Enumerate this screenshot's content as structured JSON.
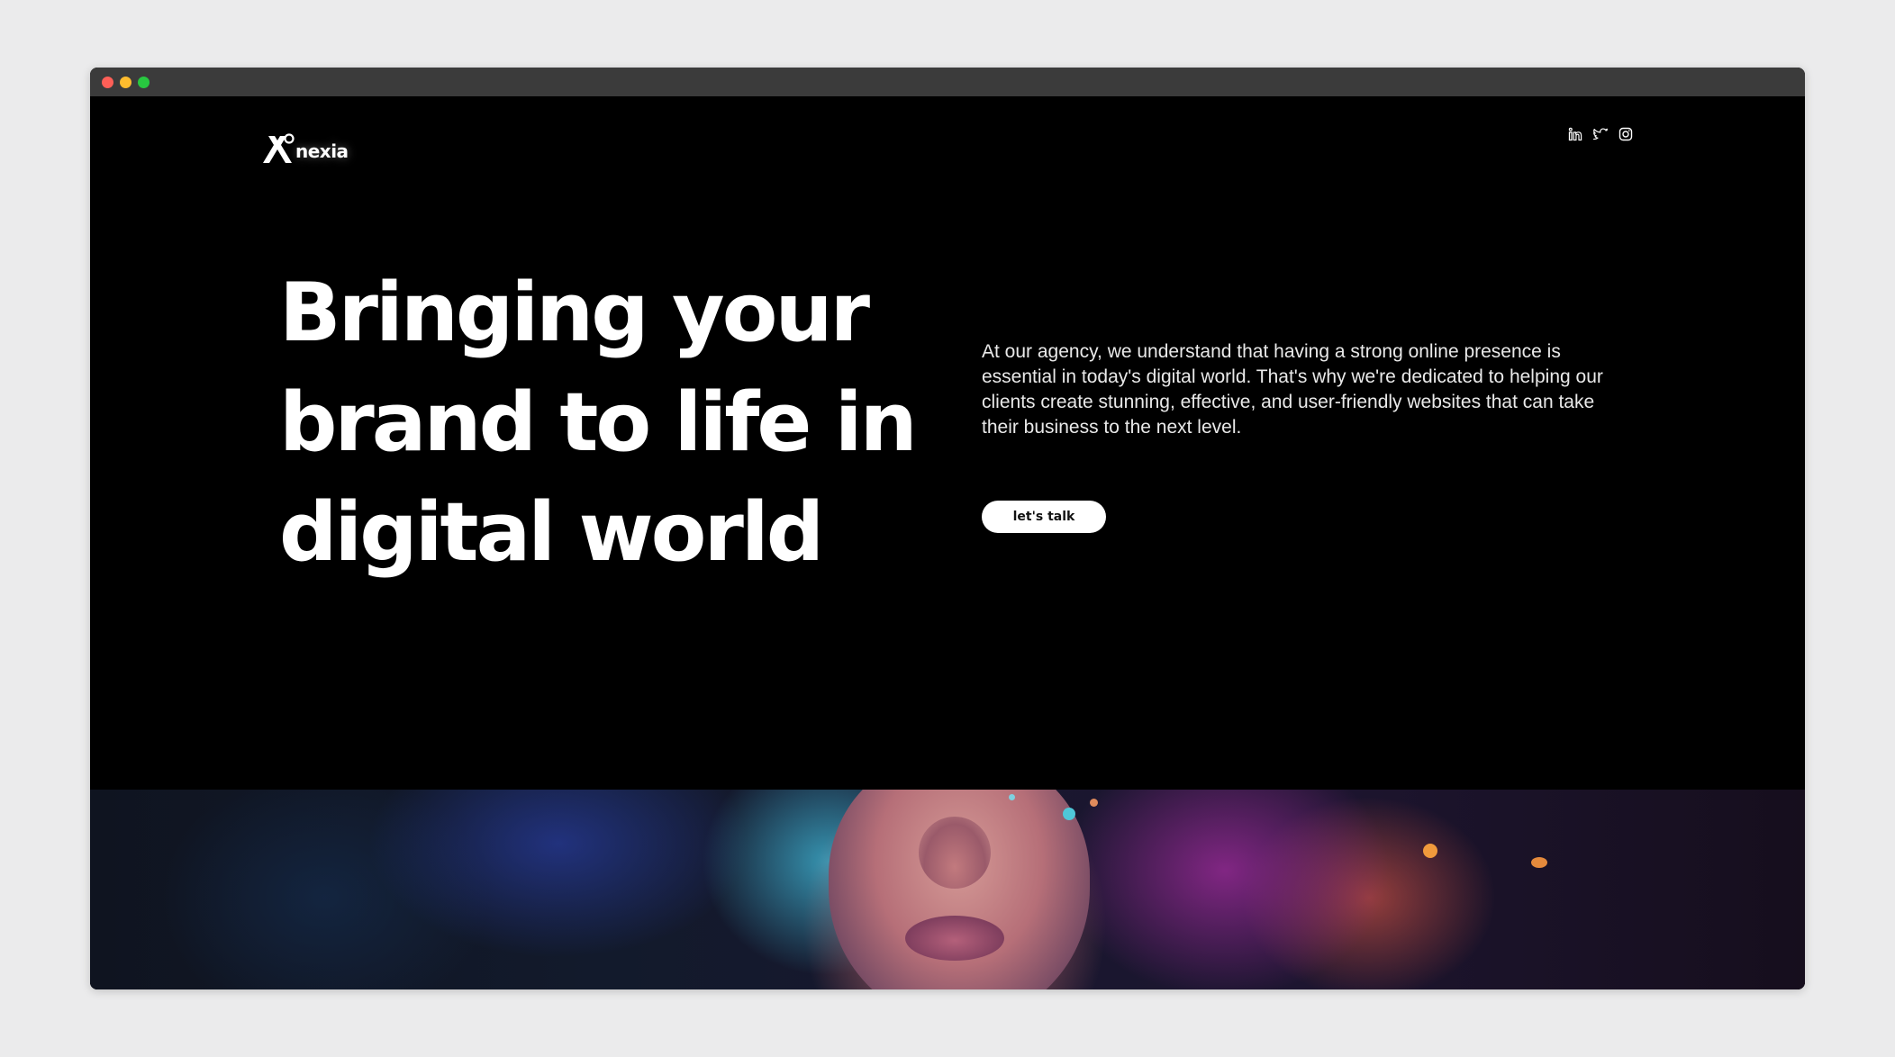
{
  "window": {
    "controls": [
      "close",
      "minimize",
      "maximize"
    ]
  },
  "header": {
    "logo_text": "nexia",
    "social_icons": [
      "linkedin-icon",
      "twitter-icon",
      "instagram-icon"
    ]
  },
  "hero": {
    "headline": "Bringing your brand to life in digital world",
    "intro": "At our agency, we understand that having a strong online presence is essential in today's digital world. That's why we're dedicated to helping our clients create stunning, effective, and user-friendly websites that can take their business to the next level.",
    "cta_label": "let's talk"
  },
  "colors": {
    "background": "#000000",
    "text": "#ffffff",
    "button_bg": "#ffffff",
    "button_text": "#111111"
  }
}
